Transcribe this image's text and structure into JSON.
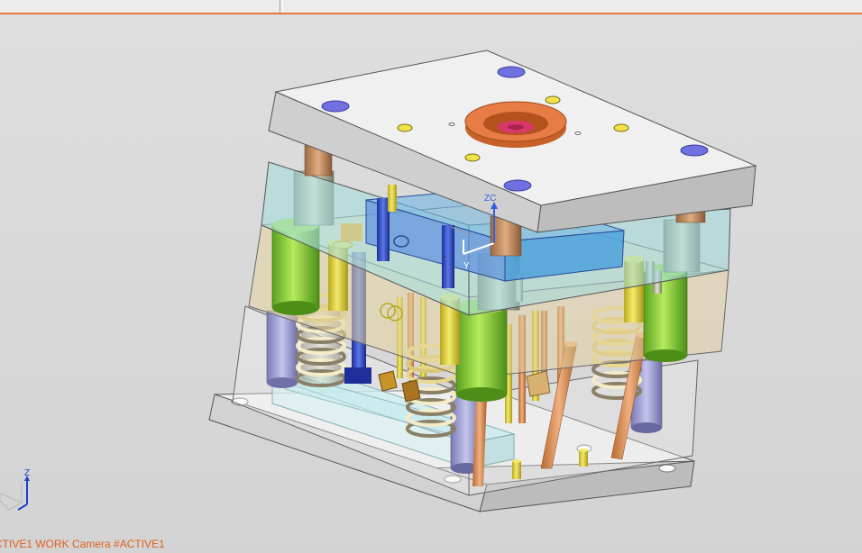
{
  "status": {
    "text": "CTIVE1 WORK Camera #ACTIVE1"
  },
  "csys": {
    "z_label": "ZC",
    "y_label": "Y"
  },
  "triad": {
    "z_label": "Z"
  },
  "colors": {
    "accent": "#e07a3c",
    "top_plate": "#f0f0f0",
    "cavity_plate": "#a9dede",
    "core_plate": "#e8dca8",
    "guide_pillar": "#8ed23c",
    "return_pin": "#e0d43c",
    "ejector_pin": "#e08c4c",
    "locating_ring": "#e0763c",
    "spring": "#f2e6b0",
    "blue_insert": "#2f4fc4"
  },
  "model": {
    "name": "mold-assembly"
  }
}
